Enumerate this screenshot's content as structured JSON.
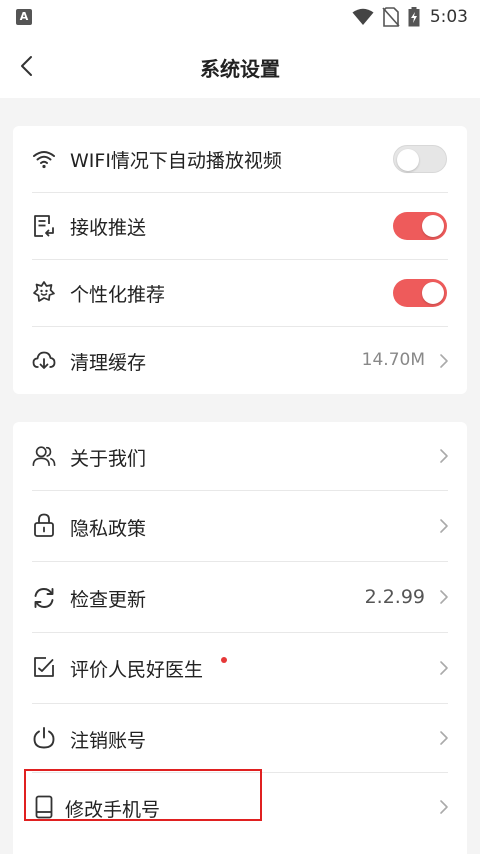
{
  "status_bar": {
    "app_icon": "a-app-icon",
    "time": "5:03",
    "icons": [
      "wifi-icon",
      "no-sim-icon",
      "battery-charging-icon"
    ]
  },
  "header": {
    "title": "系统设置",
    "back_icon": "chevron-left-icon"
  },
  "settings_group": [
    {
      "id": "autoplay",
      "icon": "wifi-icon",
      "label": "WIFI情况下自动播放视频",
      "control": "toggle",
      "enabled": false
    },
    {
      "id": "push",
      "icon": "receive-push-icon",
      "label": "接收推送",
      "control": "toggle",
      "enabled": true
    },
    {
      "id": "personalized",
      "icon": "sparkle-badge-icon",
      "label": "个性化推荐",
      "control": "toggle",
      "enabled": true
    },
    {
      "id": "cache",
      "icon": "cloud-download-icon",
      "label": "清理缓存",
      "control": "chevron",
      "value": "14.70M"
    }
  ],
  "info_group": [
    {
      "id": "about",
      "icon": "users-icon",
      "label": "关于我们"
    },
    {
      "id": "privacy",
      "icon": "lock-icon",
      "label": "隐私政策"
    },
    {
      "id": "update",
      "icon": "refresh-icon",
      "label": "检查更新",
      "value": "2.2.99"
    },
    {
      "id": "rate",
      "icon": "edit-box-icon",
      "label": "评价人民好医生",
      "badge_dot": true
    },
    {
      "id": "deactivate",
      "icon": "power-icon",
      "label": "注销账号"
    },
    {
      "id": "change_phone",
      "icon": "phone-icon",
      "label": "修改手机号"
    }
  ],
  "colors": {
    "accent": "#ee5b5b",
    "toggle_off": "#e6e6e6",
    "highlight": "#e02020",
    "background": "#f4f4f4"
  }
}
